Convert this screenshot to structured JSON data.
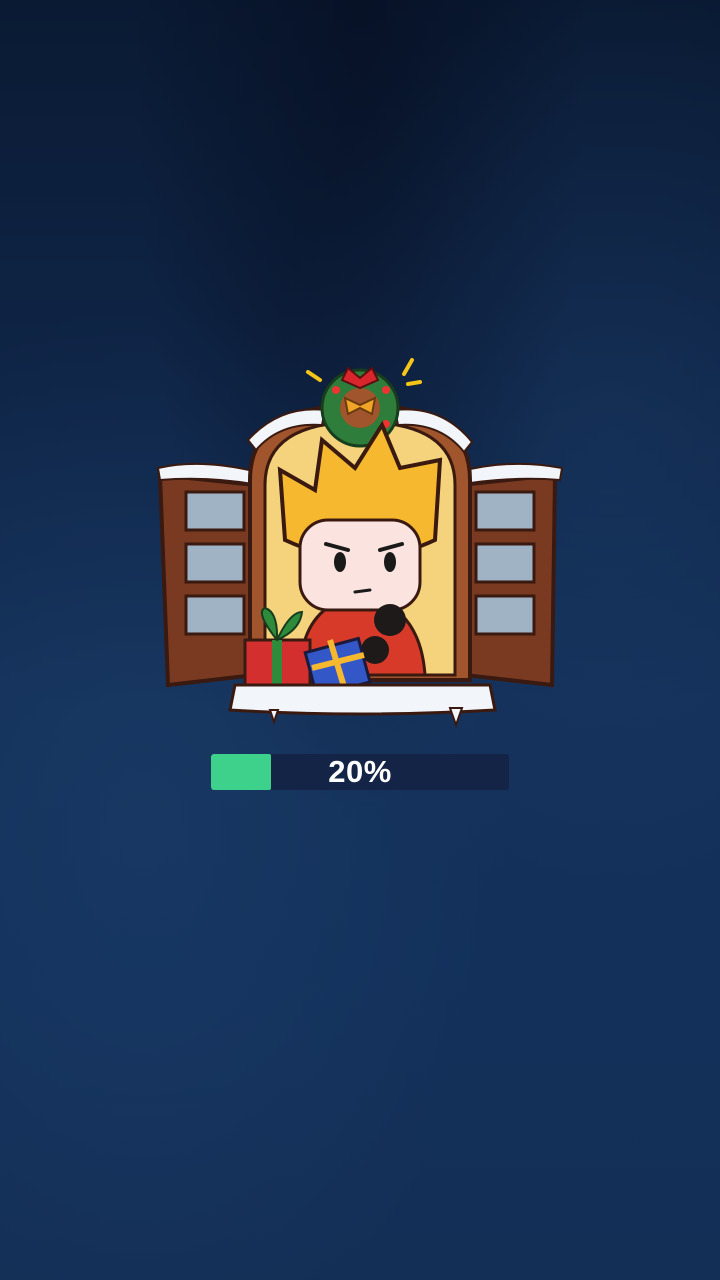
{
  "loading": {
    "progress_label": "20%",
    "progress_fraction": 0.2,
    "fill_color": "#3ed18c",
    "track_color": "#132447"
  },
  "illustration": {
    "icon": "christmas-window-character-icon"
  },
  "colors": {
    "background_top": "#0a1a33",
    "background_bottom": "#142f56"
  }
}
